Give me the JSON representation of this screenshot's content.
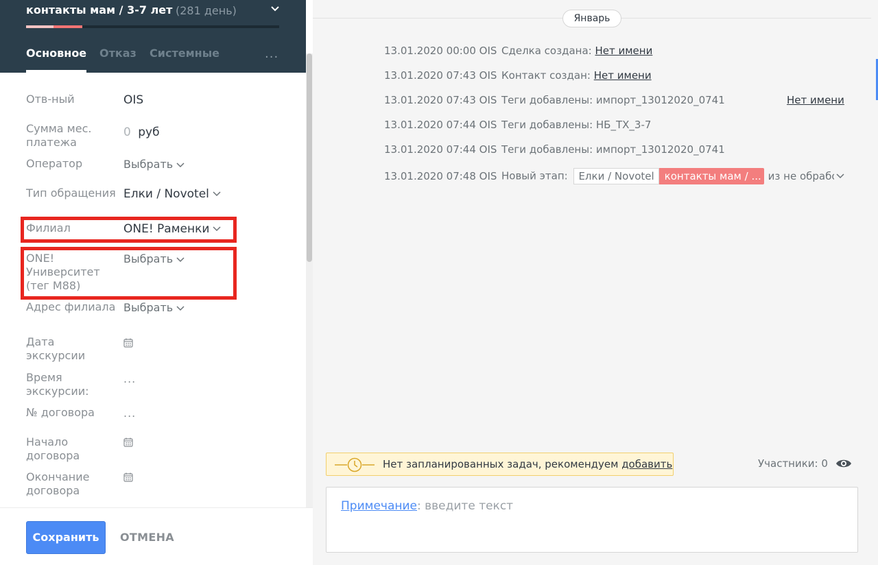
{
  "lead": {
    "title": "контакты мам / 3-7 лет",
    "days": "(281 день)",
    "pipeline_progress": 0.22
  },
  "tabs": [
    "Основное",
    "Отказ",
    "Системные"
  ],
  "tabs_more": "...",
  "fields": {
    "responsible": {
      "label": "Отв-ный",
      "value": "OIS"
    },
    "monthly_payment": {
      "label": "Сумма мес. платежа",
      "value": "0",
      "unit": "руб"
    },
    "operator": {
      "label": "Оператор",
      "value": "Выбрать"
    },
    "request_type": {
      "label": "Тип обращения",
      "value": "Елки / Novotel"
    },
    "branch": {
      "label": "Филиал",
      "value": "ONE! Раменки"
    },
    "university": {
      "label": "ONE! Университет (тег M88)",
      "value": "Выбрать"
    },
    "branch_address": {
      "label": "Адрес филиала",
      "value": "Выбрать"
    },
    "tour_date": {
      "label": "Дата экскурсии"
    },
    "tour_time": {
      "label": "Время экскурсии:",
      "value": "..."
    },
    "contract_no": {
      "label": "№ договора",
      "value": "..."
    },
    "contract_start": {
      "label": "Начало договора"
    },
    "contract_end": {
      "label": "Окончание договора"
    }
  },
  "footer": {
    "save": "Сохранить",
    "cancel": "ОТМЕНА"
  },
  "feed": {
    "month": "Январь",
    "events": [
      {
        "ts": "13.01.2020 00:00 OIS",
        "text": "Сделка создана: ",
        "link": "Нет имени"
      },
      {
        "ts": "13.01.2020 07:43 OIS",
        "text": "Контакт создан: ",
        "link": "Нет имени"
      },
      {
        "ts": "13.01.2020 07:43 OIS",
        "text": "Теги добавлены: импорт_13012020_0741",
        "right_link": "Нет имени"
      },
      {
        "ts": "13.01.2020 07:44 OIS",
        "text": "Теги добавлены: НБ_ТХ_3-7"
      },
      {
        "ts": "13.01.2020 07:44 OIS",
        "text": "Теги добавлены: импорт_13012020_0741"
      },
      {
        "ts": "13.01.2020 07:48 OIS",
        "text": "Новый этап: ",
        "stage_old": "Елки / Novotel",
        "stage_new": "контакты мам / ...",
        "stage_from": "из не обработ"
      }
    ]
  },
  "tasks": {
    "text": "Нет запланированных задач, рекомендуем ",
    "add": "добавить"
  },
  "participants": "Участники: 0",
  "note": {
    "type": "Примечание",
    "placeholder": ": введите текст"
  },
  "colors": {
    "header": "#2b3e4b",
    "accent": "#4c8bf5",
    "stage": "#f37e7e",
    "highlight": "#e8261f"
  }
}
